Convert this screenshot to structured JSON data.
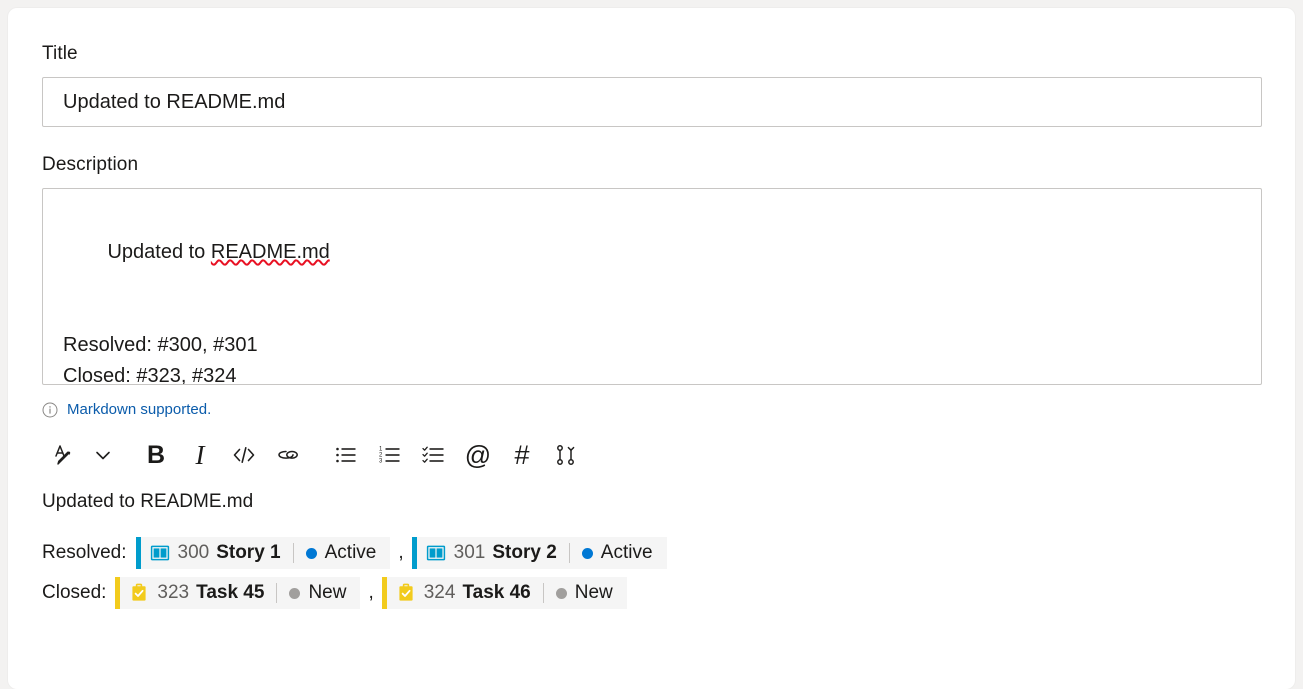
{
  "form": {
    "title_label": "Title",
    "title_value": "Updated to README.md",
    "title_placeholder": "Enter a title",
    "description_label": "Description",
    "description_lines": [
      "Updated to README.md",
      "",
      "Resolved: #300, #301",
      "Closed: #323, #324"
    ],
    "description_spellcheck_word": "README.md",
    "markdown_hint": "Markdown supported.",
    "markdown_hint_icon": "info-circle-icon"
  },
  "toolbar": {
    "items": [
      {
        "name": "text-style-icon",
        "label": "Text style",
        "glyph": ""
      },
      {
        "name": "chevron-down-icon",
        "label": "More text styles",
        "glyph": ""
      },
      {
        "name": "bold-icon",
        "label": "Bold",
        "glyph": "B"
      },
      {
        "name": "italic-icon",
        "label": "Italic",
        "glyph": "I"
      },
      {
        "name": "code-icon",
        "label": "Code",
        "glyph": "</>"
      },
      {
        "name": "link-icon",
        "label": "Link",
        "glyph": ""
      },
      {
        "name": "bulleted-list-icon",
        "label": "Bulleted list",
        "glyph": ""
      },
      {
        "name": "numbered-list-icon",
        "label": "Numbered list",
        "glyph": ""
      },
      {
        "name": "checklist-icon",
        "label": "Checklist",
        "glyph": ""
      },
      {
        "name": "mention-icon",
        "label": "Mention",
        "glyph": "@"
      },
      {
        "name": "hashtag-icon",
        "label": "Link work item",
        "glyph": "#"
      },
      {
        "name": "pull-request-icon",
        "label": "Pull request",
        "glyph": ""
      }
    ]
  },
  "preview": {
    "paragraph": "Updated to README.md",
    "rows": [
      {
        "label": "Resolved:",
        "separator": ",",
        "chips": [
          {
            "id": "300",
            "title": "Story 1",
            "state": "Active",
            "type": "User Story",
            "icon": "book-icon",
            "accent_color": "#009CCC",
            "icon_color": "#009CCC",
            "state_color": "#0078d4"
          },
          {
            "id": "301",
            "title": "Story 2",
            "state": "Active",
            "type": "User Story",
            "icon": "book-icon",
            "accent_color": "#009CCC",
            "icon_color": "#009CCC",
            "state_color": "#0078d4"
          }
        ]
      },
      {
        "label": "Closed:",
        "separator": ",",
        "chips": [
          {
            "id": "323",
            "title": "Task 45",
            "state": "New",
            "type": "Task",
            "icon": "clipboard-check-icon",
            "accent_color": "#F2CB1D",
            "icon_color": "#F2CB1D",
            "state_color": "#a19f9d"
          },
          {
            "id": "324",
            "title": "Task 46",
            "state": "New",
            "type": "Task",
            "icon": "clipboard-check-icon",
            "accent_color": "#F2CB1D",
            "icon_color": "#F2CB1D",
            "state_color": "#a19f9d"
          }
        ]
      }
    ]
  },
  "colors": {
    "page_background": "#f3f2f1",
    "card_background": "#ffffff",
    "chip_background": "#f5f5f5",
    "link": "#0b5cab",
    "border": "#c8c6c4",
    "spellcheck": "#e81123"
  }
}
